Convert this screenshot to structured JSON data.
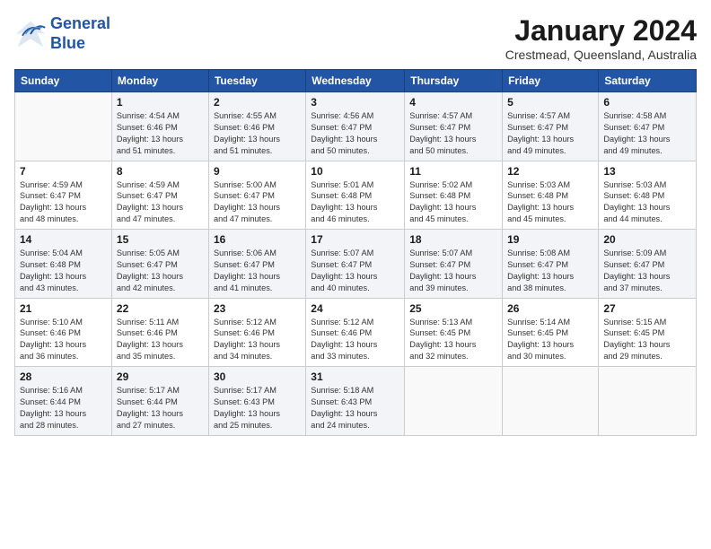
{
  "logo": {
    "line1": "General",
    "line2": "Blue"
  },
  "title": {
    "month_year": "January 2024",
    "location": "Crestmead, Queensland, Australia"
  },
  "weekdays": [
    "Sunday",
    "Monday",
    "Tuesday",
    "Wednesday",
    "Thursday",
    "Friday",
    "Saturday"
  ],
  "weeks": [
    [
      {
        "day": "",
        "info": ""
      },
      {
        "day": "1",
        "info": "Sunrise: 4:54 AM\nSunset: 6:46 PM\nDaylight: 13 hours\nand 51 minutes."
      },
      {
        "day": "2",
        "info": "Sunrise: 4:55 AM\nSunset: 6:46 PM\nDaylight: 13 hours\nand 51 minutes."
      },
      {
        "day": "3",
        "info": "Sunrise: 4:56 AM\nSunset: 6:47 PM\nDaylight: 13 hours\nand 50 minutes."
      },
      {
        "day": "4",
        "info": "Sunrise: 4:57 AM\nSunset: 6:47 PM\nDaylight: 13 hours\nand 50 minutes."
      },
      {
        "day": "5",
        "info": "Sunrise: 4:57 AM\nSunset: 6:47 PM\nDaylight: 13 hours\nand 49 minutes."
      },
      {
        "day": "6",
        "info": "Sunrise: 4:58 AM\nSunset: 6:47 PM\nDaylight: 13 hours\nand 49 minutes."
      }
    ],
    [
      {
        "day": "7",
        "info": "Sunrise: 4:59 AM\nSunset: 6:47 PM\nDaylight: 13 hours\nand 48 minutes."
      },
      {
        "day": "8",
        "info": "Sunrise: 4:59 AM\nSunset: 6:47 PM\nDaylight: 13 hours\nand 47 minutes."
      },
      {
        "day": "9",
        "info": "Sunrise: 5:00 AM\nSunset: 6:47 PM\nDaylight: 13 hours\nand 47 minutes."
      },
      {
        "day": "10",
        "info": "Sunrise: 5:01 AM\nSunset: 6:48 PM\nDaylight: 13 hours\nand 46 minutes."
      },
      {
        "day": "11",
        "info": "Sunrise: 5:02 AM\nSunset: 6:48 PM\nDaylight: 13 hours\nand 45 minutes."
      },
      {
        "day": "12",
        "info": "Sunrise: 5:03 AM\nSunset: 6:48 PM\nDaylight: 13 hours\nand 45 minutes."
      },
      {
        "day": "13",
        "info": "Sunrise: 5:03 AM\nSunset: 6:48 PM\nDaylight: 13 hours\nand 44 minutes."
      }
    ],
    [
      {
        "day": "14",
        "info": "Sunrise: 5:04 AM\nSunset: 6:48 PM\nDaylight: 13 hours\nand 43 minutes."
      },
      {
        "day": "15",
        "info": "Sunrise: 5:05 AM\nSunset: 6:47 PM\nDaylight: 13 hours\nand 42 minutes."
      },
      {
        "day": "16",
        "info": "Sunrise: 5:06 AM\nSunset: 6:47 PM\nDaylight: 13 hours\nand 41 minutes."
      },
      {
        "day": "17",
        "info": "Sunrise: 5:07 AM\nSunset: 6:47 PM\nDaylight: 13 hours\nand 40 minutes."
      },
      {
        "day": "18",
        "info": "Sunrise: 5:07 AM\nSunset: 6:47 PM\nDaylight: 13 hours\nand 39 minutes."
      },
      {
        "day": "19",
        "info": "Sunrise: 5:08 AM\nSunset: 6:47 PM\nDaylight: 13 hours\nand 38 minutes."
      },
      {
        "day": "20",
        "info": "Sunrise: 5:09 AM\nSunset: 6:47 PM\nDaylight: 13 hours\nand 37 minutes."
      }
    ],
    [
      {
        "day": "21",
        "info": "Sunrise: 5:10 AM\nSunset: 6:46 PM\nDaylight: 13 hours\nand 36 minutes."
      },
      {
        "day": "22",
        "info": "Sunrise: 5:11 AM\nSunset: 6:46 PM\nDaylight: 13 hours\nand 35 minutes."
      },
      {
        "day": "23",
        "info": "Sunrise: 5:12 AM\nSunset: 6:46 PM\nDaylight: 13 hours\nand 34 minutes."
      },
      {
        "day": "24",
        "info": "Sunrise: 5:12 AM\nSunset: 6:46 PM\nDaylight: 13 hours\nand 33 minutes."
      },
      {
        "day": "25",
        "info": "Sunrise: 5:13 AM\nSunset: 6:45 PM\nDaylight: 13 hours\nand 32 minutes."
      },
      {
        "day": "26",
        "info": "Sunrise: 5:14 AM\nSunset: 6:45 PM\nDaylight: 13 hours\nand 30 minutes."
      },
      {
        "day": "27",
        "info": "Sunrise: 5:15 AM\nSunset: 6:45 PM\nDaylight: 13 hours\nand 29 minutes."
      }
    ],
    [
      {
        "day": "28",
        "info": "Sunrise: 5:16 AM\nSunset: 6:44 PM\nDaylight: 13 hours\nand 28 minutes."
      },
      {
        "day": "29",
        "info": "Sunrise: 5:17 AM\nSunset: 6:44 PM\nDaylight: 13 hours\nand 27 minutes."
      },
      {
        "day": "30",
        "info": "Sunrise: 5:17 AM\nSunset: 6:43 PM\nDaylight: 13 hours\nand 25 minutes."
      },
      {
        "day": "31",
        "info": "Sunrise: 5:18 AM\nSunset: 6:43 PM\nDaylight: 13 hours\nand 24 minutes."
      },
      {
        "day": "",
        "info": ""
      },
      {
        "day": "",
        "info": ""
      },
      {
        "day": "",
        "info": ""
      }
    ]
  ]
}
